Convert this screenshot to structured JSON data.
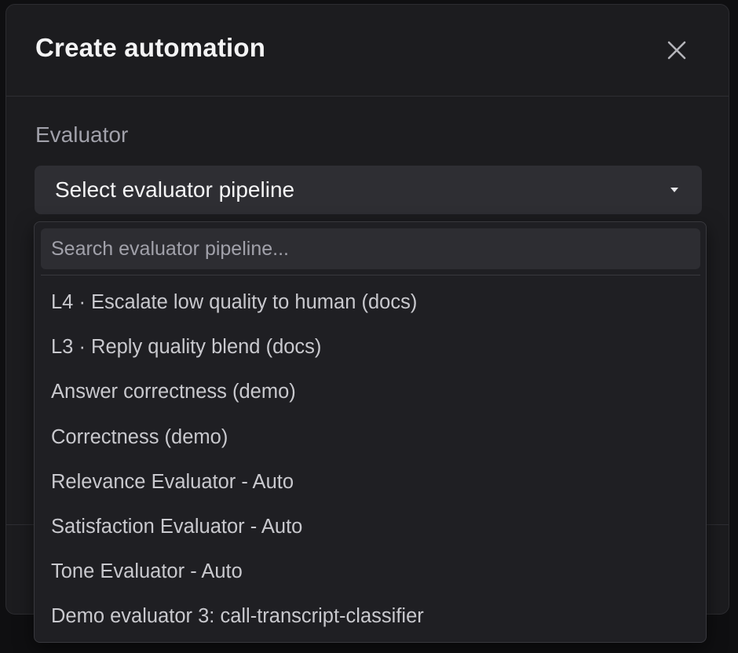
{
  "modal": {
    "title": "Create automation",
    "close_icon": "close-icon"
  },
  "form": {
    "evaluator_label": "Evaluator",
    "evaluator_select": {
      "value": "Select evaluator pipeline",
      "caret_icon": "caret-down-icon"
    }
  },
  "dropdown": {
    "search_placeholder": "Search evaluator pipeline...",
    "search_value": "",
    "options": [
      {
        "label": "L4 · Escalate low quality to human (docs)"
      },
      {
        "label": "L3 · Reply quality blend (docs)"
      },
      {
        "label": "Answer correctness (demo)"
      },
      {
        "label": "Correctness (demo)"
      },
      {
        "label": "Relevance Evaluator - Auto"
      },
      {
        "label": "Satisfaction Evaluator - Auto"
      },
      {
        "label": "Tone Evaluator - Auto"
      },
      {
        "label": "Demo evaluator 3: call-transcript-classifier"
      }
    ]
  },
  "colors": {
    "modal_bg": "#1c1c1f",
    "select_bg": "#2e2e33",
    "dropdown_bg": "#1f1f23",
    "text_primary": "#f4f4f5",
    "text_muted": "#a1a1aa"
  }
}
